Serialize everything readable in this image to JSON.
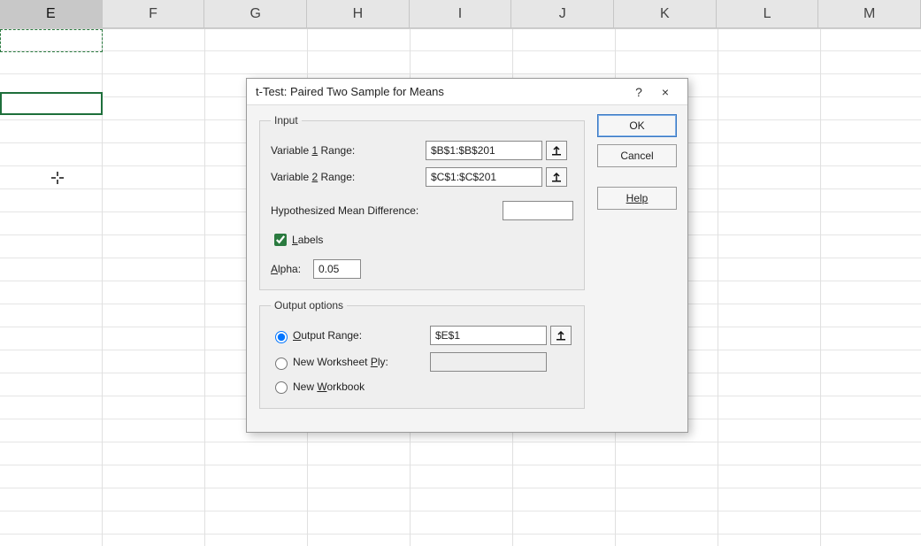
{
  "columns": [
    "E",
    "F",
    "G",
    "H",
    "I",
    "J",
    "K",
    "L",
    "M"
  ],
  "selected_column": "E",
  "dialog": {
    "title": "t-Test: Paired Two Sample for Means",
    "help_icon_char": "?",
    "close_icon_char": "×",
    "buttons": {
      "ok": "OK",
      "cancel": "Cancel",
      "help": "Help"
    },
    "input": {
      "legend": "Input",
      "var1_label_pre": "Variable ",
      "var1_label_und": "1",
      "var1_label_post": " Range:",
      "var1_value": "$B$1:$B$201",
      "var2_label_pre": "Variable ",
      "var2_label_und": "2",
      "var2_label_post": " Range:",
      "var2_value": "$C$1:$C$201",
      "hypo_label": "Hypothesized Mean Difference:",
      "hypo_value": "",
      "labels_pre": "",
      "labels_und": "L",
      "labels_post": "abels",
      "labels_checked": true,
      "alpha_pre": "",
      "alpha_und": "A",
      "alpha_post": "lpha:",
      "alpha_value": "0.05"
    },
    "output": {
      "legend": "Output options",
      "range_pre": "",
      "range_und": "O",
      "range_post": "utput Range:",
      "range_value": "$E$1",
      "range_selected": true,
      "ply_label_pre": "New Worksheet ",
      "ply_label_und": "P",
      "ply_label_post": "ly:",
      "ply_value": "",
      "wb_label_pre": "New ",
      "wb_label_und": "W",
      "wb_label_post": "orkbook"
    }
  }
}
